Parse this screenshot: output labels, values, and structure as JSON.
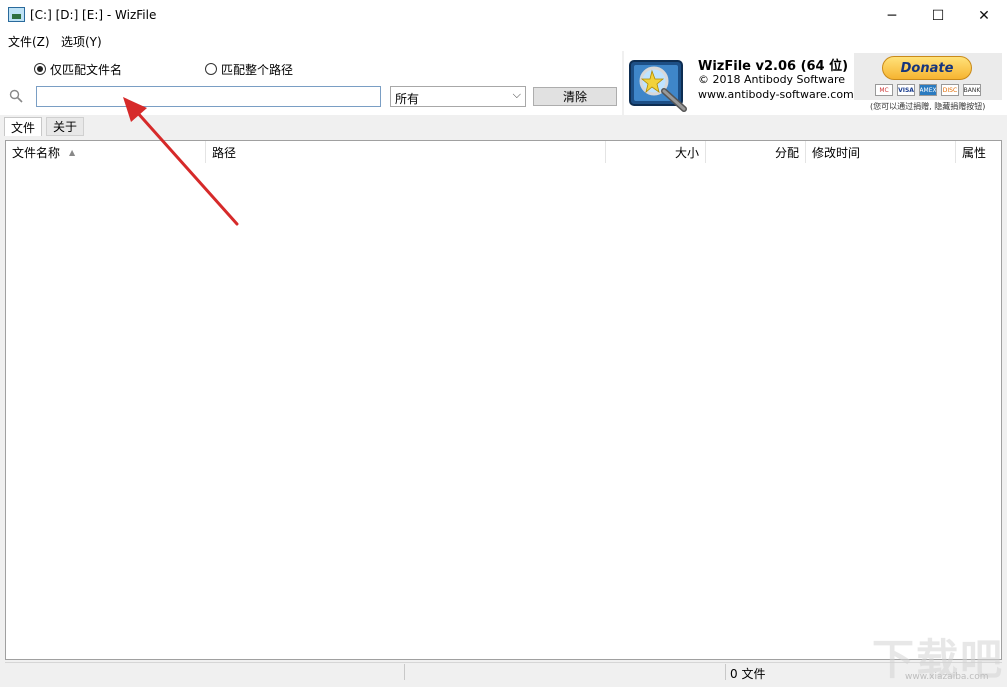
{
  "window": {
    "title": "[C:] [D:] [E:]  - WizFile",
    "minimize_icon": "─",
    "maximize_icon": "☐",
    "close_icon": "✕"
  },
  "menu": {
    "file": "文件(Z)",
    "options": "选项(Y)"
  },
  "search": {
    "radio_filename": "仅匹配文件名",
    "radio_path": "匹配整个路径",
    "selected_radio": "filename",
    "input_value": "",
    "filter_value": "所有",
    "clear_label": "清除"
  },
  "info": {
    "name": "WizFile v2.06 (64 位)",
    "copyright": "© 2018 Antibody Software",
    "url": "www.antibody-software.com",
    "donate_label": "Donate",
    "cards": [
      "MC",
      "VISA",
      "AMEX",
      "DISC",
      "BANK"
    ],
    "note": "(您可以通过捐赠, 隐藏捐赠按钮)"
  },
  "tabs": [
    "文件",
    "关于"
  ],
  "columns": [
    "文件名称",
    "路径",
    "大小",
    "分配",
    "修改时间",
    "属性"
  ],
  "status": {
    "count": "0 文件"
  },
  "watermark": {
    "text": "下载吧",
    "url": "www.xiazaiba.com"
  },
  "colors": {
    "arrow": "#d62a2a",
    "input_border": "#7a9ec4",
    "donate": "#f6b431"
  }
}
